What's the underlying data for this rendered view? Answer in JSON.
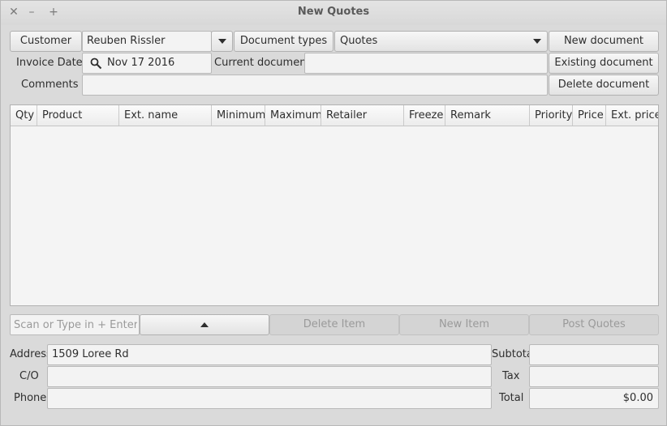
{
  "window": {
    "title": "New Quotes",
    "close_glyph": "✕",
    "minimize_glyph": "–",
    "maximize_glyph": "+"
  },
  "header": {
    "customer_button": "Customer",
    "customer_value": "Reuben Rissler",
    "document_types_button": "Document types",
    "document_type_value": "Quotes",
    "new_document_button": "New document",
    "invoice_date_label": "Invoice Date",
    "invoice_date_value": "Nov 17 2016",
    "current_document_label": "Current document :",
    "current_document_value": "",
    "existing_document_button": "Existing document",
    "comments_label": "Comments",
    "comments_value": "",
    "delete_document_button": "Delete document"
  },
  "table": {
    "columns": [
      "Qty",
      "Product",
      "Ext. name",
      "Minimum",
      "Maximum",
      "Retailer",
      "Freeze",
      "Remark",
      "Priority",
      "Price",
      "Ext. price"
    ]
  },
  "toolbar": {
    "scan_placeholder": "Scan or Type in + Enter",
    "delete_item_button": "Delete Item",
    "new_item_button": "New Item",
    "post_quotes_button": "Post Quotes"
  },
  "footer": {
    "address_label": "Address",
    "address_value": "1509 Loree Rd",
    "co_label": "C/O",
    "co_value": "",
    "phone_label": "Phone",
    "phone_value": "",
    "subtotal_label": "Subtotal",
    "subtotal_value": "",
    "tax_label": "Tax",
    "tax_value": "",
    "total_label": "Total",
    "total_value": "$0.00"
  },
  "icons": {
    "search": "search-icon",
    "dropdown": "chevron-down-icon",
    "up": "arrow-up-icon"
  }
}
